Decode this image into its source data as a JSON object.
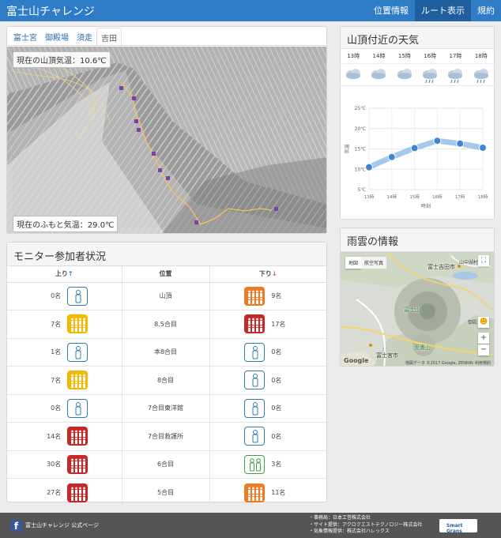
{
  "navbar": {
    "brand": "富士山チャレンジ",
    "items": [
      {
        "label": "位置情報",
        "active": false
      },
      {
        "label": "ルート表示",
        "active": true
      },
      {
        "label": "規約",
        "active": false
      }
    ]
  },
  "route": {
    "tabs": [
      {
        "label": "富士宮",
        "active": false
      },
      {
        "label": "御殿場",
        "active": false
      },
      {
        "label": "須走",
        "active": false
      },
      {
        "label": "吉田",
        "active": true
      }
    ],
    "summit_temp": "現在の山頂気温：10.6℃",
    "base_temp": "現在のふもと気温：29.0℃"
  },
  "monitor": {
    "title": "モニター参加者状況",
    "headers": {
      "up": "上り",
      "position": "位置",
      "down": "下り"
    },
    "rows": [
      {
        "up": "0名",
        "up_level": "empty",
        "position": "山頂",
        "down": "9名",
        "down_level": "orange"
      },
      {
        "up": "7名",
        "up_level": "yellow",
        "position": "8.5合目",
        "down": "17名",
        "down_level": "red"
      },
      {
        "up": "1名",
        "up_level": "empty",
        "position": "本8合目",
        "down": "0名",
        "down_level": "empty"
      },
      {
        "up": "7名",
        "up_level": "yellow",
        "position": "8合目",
        "down": "0名",
        "down_level": "empty"
      },
      {
        "up": "0名",
        "up_level": "empty",
        "position": "7合目東洋館",
        "down": "0名",
        "down_level": "empty"
      },
      {
        "up": "14名",
        "up_level": "red",
        "position": "7合目救護所",
        "down": "0名",
        "down_level": "empty"
      },
      {
        "up": "30名",
        "up_level": "red",
        "position": "6合目",
        "down": "3名",
        "down_level": "green"
      },
      {
        "up": "27名",
        "up_level": "red",
        "position": "5合目",
        "down": "11名",
        "down_level": "orange"
      }
    ],
    "level_colors": {
      "empty": "#2e7fa3",
      "yellow": "#f5b800",
      "red": "#c62828",
      "orange": "#ee7a22",
      "green": "#43a047"
    }
  },
  "weather": {
    "title": "山頂付近の天気",
    "hours": [
      "13時",
      "14時",
      "15時",
      "16時",
      "17時",
      "18時"
    ],
    "icons": [
      "cloud-icon",
      "cloud-icon",
      "cloud-icon",
      "rain-icon",
      "rain-icon",
      "rain-icon"
    ],
    "chart_data": {
      "type": "line",
      "x": [
        "13時",
        "14時",
        "15時",
        "16時",
        "17時",
        "18時"
      ],
      "series": [
        {
          "values": [
            10.5,
            13,
            15.2,
            17,
            16.3,
            15.3
          ]
        }
      ],
      "ylabel": "気温",
      "xlabel": "時刻",
      "yticks": [
        "25℃",
        "20℃",
        "15℃",
        "10℃",
        "5℃"
      ],
      "ylim": [
        5,
        25
      ],
      "grid": true,
      "color": "#7fb2e5"
    }
  },
  "rain": {
    "title": "雨雲の情報",
    "map_tabs": [
      "地図",
      "航空写真"
    ],
    "labels": [
      {
        "text": "富士吉田市"
      },
      {
        "text": "山中湖村"
      },
      {
        "text": "富士山"
      },
      {
        "text": "御殿"
      },
      {
        "text": "愛鷹山"
      },
      {
        "text": "富士宮市"
      }
    ],
    "attribution": "地図データ ©2017 Google, ZENRIN",
    "terms": "利用規約",
    "google": "Google"
  },
  "footer": {
    "fb_text": "富士山チャレンジ 公式ページ",
    "credits": [
      "・事務局：日本工営株式会社",
      "・サイト提供：アクロクエストテクノロジー株式会社",
      "・気象情報提供：株式会社ハレックス"
    ],
    "logo_text": "Smart Grans"
  }
}
